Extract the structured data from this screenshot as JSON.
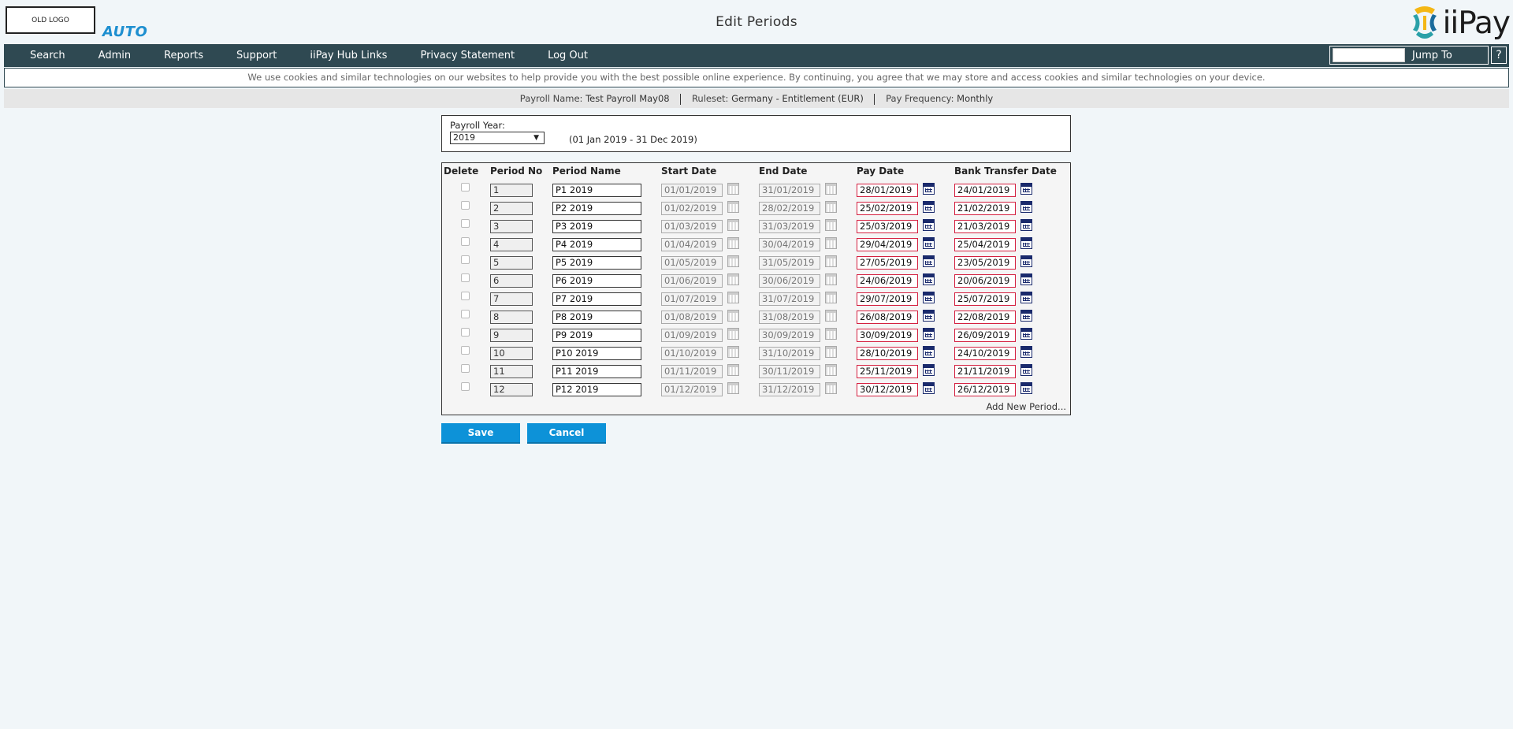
{
  "header": {
    "old_logo": "OLD LOGO",
    "auto_label": "AUTO",
    "title": "Edit Periods",
    "brand_name": "iiPay",
    "brand_colors": [
      "#f4b715",
      "#2aa0a8",
      "#1a6b9c"
    ]
  },
  "nav": {
    "items": [
      {
        "label": "Search"
      },
      {
        "label": "Admin"
      },
      {
        "label": "Reports"
      },
      {
        "label": "Support"
      },
      {
        "label": "iiPay Hub Links"
      },
      {
        "label": "Privacy Statement"
      },
      {
        "label": "Log Out"
      }
    ],
    "jump_value": "",
    "jump_label": "Jump To",
    "help_label": "?"
  },
  "cookie_text": "We use cookies and similar technologies on our websites to help provide you with the best possible online experience. By continuing, you agree that we may store and access cookies and similar technologies on your device.",
  "info": {
    "payroll_name_label": "Payroll Name:",
    "payroll_name": "Test Payroll May08",
    "ruleset_label": "Ruleset:",
    "ruleset": "Germany - Entitlement (EUR)",
    "frequency_label": "Pay Frequency:",
    "frequency": "Monthly"
  },
  "year": {
    "label": "Payroll Year:",
    "selected": "2019",
    "caret": "▼",
    "range": "(01 Jan 2019 - 31 Dec 2019)"
  },
  "columns": {
    "delete": "Delete",
    "period_no": "Period No",
    "period_name": "Period Name",
    "start_date": "Start Date",
    "end_date": "End Date",
    "pay_date": "Pay Date",
    "bank_date": "Bank Transfer Date"
  },
  "periods": [
    {
      "no": "1",
      "name": "P1 2019",
      "start": "01/01/2019",
      "end": "31/01/2019",
      "pay": "28/01/2019",
      "bank": "24/01/2019"
    },
    {
      "no": "2",
      "name": "P2 2019",
      "start": "01/02/2019",
      "end": "28/02/2019",
      "pay": "25/02/2019",
      "bank": "21/02/2019"
    },
    {
      "no": "3",
      "name": "P3 2019",
      "start": "01/03/2019",
      "end": "31/03/2019",
      "pay": "25/03/2019",
      "bank": "21/03/2019"
    },
    {
      "no": "4",
      "name": "P4 2019",
      "start": "01/04/2019",
      "end": "30/04/2019",
      "pay": "29/04/2019",
      "bank": "25/04/2019"
    },
    {
      "no": "5",
      "name": "P5 2019",
      "start": "01/05/2019",
      "end": "31/05/2019",
      "pay": "27/05/2019",
      "bank": "23/05/2019"
    },
    {
      "no": "6",
      "name": "P6 2019",
      "start": "01/06/2019",
      "end": "30/06/2019",
      "pay": "24/06/2019",
      "bank": "20/06/2019"
    },
    {
      "no": "7",
      "name": "P7 2019",
      "start": "01/07/2019",
      "end": "31/07/2019",
      "pay": "29/07/2019",
      "bank": "25/07/2019"
    },
    {
      "no": "8",
      "name": "P8 2019",
      "start": "01/08/2019",
      "end": "31/08/2019",
      "pay": "26/08/2019",
      "bank": "22/08/2019"
    },
    {
      "no": "9",
      "name": "P9 2019",
      "start": "01/09/2019",
      "end": "30/09/2019",
      "pay": "30/09/2019",
      "bank": "26/09/2019"
    },
    {
      "no": "10",
      "name": "P10 2019",
      "start": "01/10/2019",
      "end": "31/10/2019",
      "pay": "28/10/2019",
      "bank": "24/10/2019"
    },
    {
      "no": "11",
      "name": "P11 2019",
      "start": "01/11/2019",
      "end": "30/11/2019",
      "pay": "25/11/2019",
      "bank": "21/11/2019"
    },
    {
      "no": "12",
      "name": "P12 2019",
      "start": "01/12/2019",
      "end": "31/12/2019",
      "pay": "30/12/2019",
      "bank": "26/12/2019"
    }
  ],
  "add_period": "Add New Period...",
  "buttons": {
    "save": "Save",
    "cancel": "Cancel"
  },
  "colors": {
    "nav_bg": "#2f4952",
    "accent_blue": "#0d92d8",
    "required_border": "#d42040",
    "page_bg": "#f1f6f9"
  }
}
